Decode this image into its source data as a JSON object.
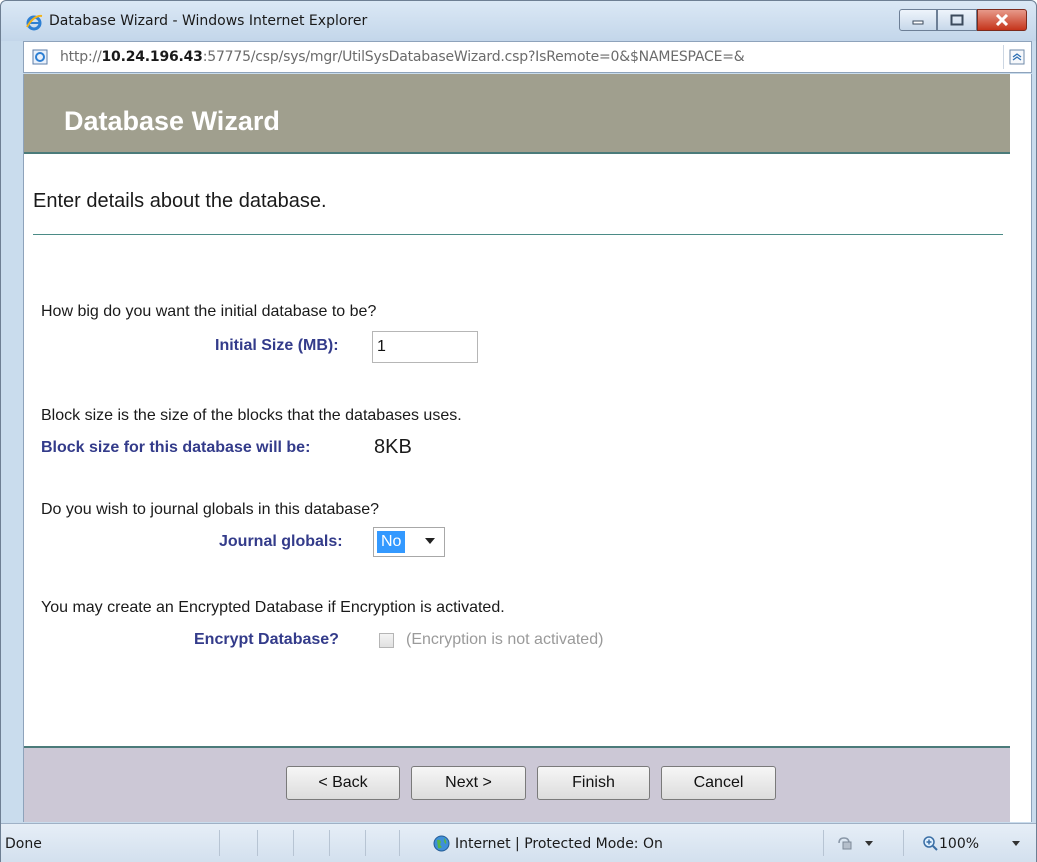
{
  "window": {
    "title": "Database Wizard - Windows Internet Explorer"
  },
  "address": {
    "prefix": "http://",
    "host": "10.24.196.43",
    "rest": ":57775/csp/sys/mgr/UtilSysDatabaseWizard.csp?IsRemote=0&$NAMESPACE=&"
  },
  "banner": {
    "title": "Database Wizard"
  },
  "intro": "Enter details about the database.",
  "size_section": {
    "question": "How big do you want the initial database to be?",
    "label": "Initial Size (MB):",
    "value": "1"
  },
  "block_section": {
    "question": "Block size is the size of the blocks that the databases uses.",
    "label": "Block size for this database will be:",
    "value": "8KB"
  },
  "journal_section": {
    "question": "Do you wish to journal globals in this database?",
    "label": "Journal globals:",
    "selected": "No"
  },
  "encrypt_section": {
    "question": "You may create an Encrypted Database if Encryption is activated.",
    "label": "Encrypt Database?",
    "note": "(Encryption is not activated)",
    "checked": false
  },
  "buttons": {
    "back": "< Back",
    "next": "Next >",
    "finish": "Finish",
    "cancel": "Cancel"
  },
  "status": {
    "text": "Done",
    "zone": "Internet | Protected Mode: On",
    "zoom": "100%"
  },
  "colors": {
    "banner": "#a09f8e",
    "label_blue": "#333b8a",
    "accent_rule": "#4b8b86",
    "footer": "#ccc8d6",
    "selection": "#3399ff"
  }
}
